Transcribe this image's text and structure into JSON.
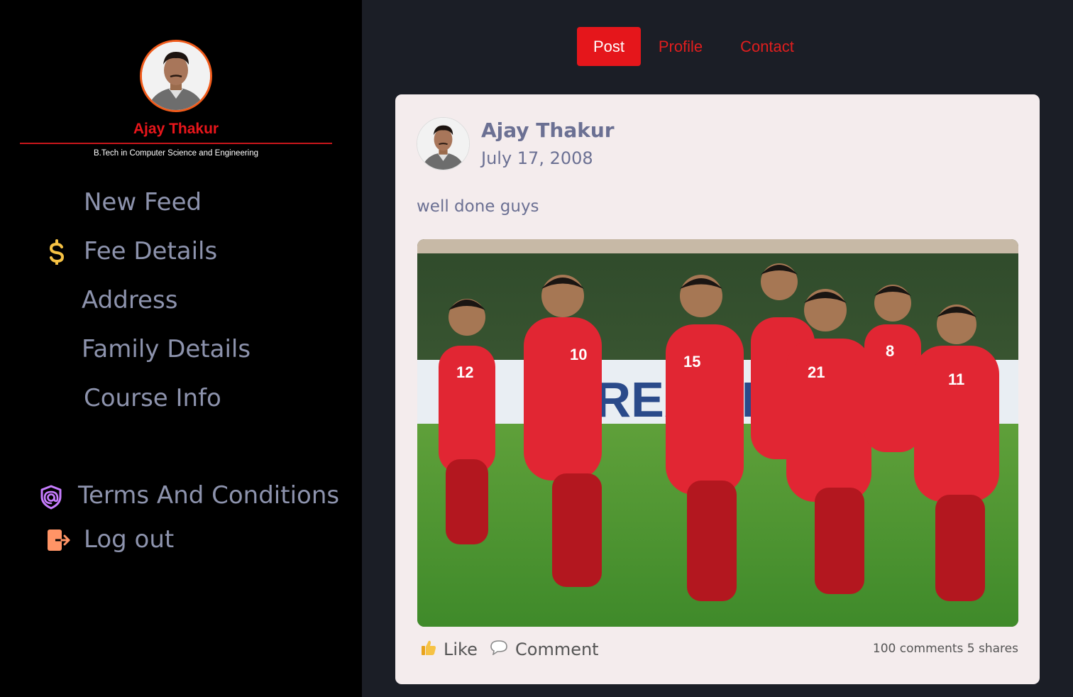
{
  "profile": {
    "name": "Ajay Thakur",
    "degree": "B.Tech in Computer Science and Engineering"
  },
  "sidebar": {
    "items": [
      {
        "label": "New Feed",
        "icon": "none"
      },
      {
        "label": "Fee Details",
        "icon": "dollar-icon"
      },
      {
        "label": "Address",
        "icon": "none"
      },
      {
        "label": "Family Details",
        "icon": "none"
      },
      {
        "label": "Course Info",
        "icon": "none"
      }
    ],
    "bottom": [
      {
        "label": "Terms And Conditions",
        "icon": "shield-at-icon"
      },
      {
        "label": "Log out",
        "icon": "logout-icon"
      }
    ]
  },
  "tabs": [
    {
      "label": "Post",
      "active": true
    },
    {
      "label": "Profile",
      "active": false
    },
    {
      "label": "Contact",
      "active": false
    }
  ],
  "post": {
    "author": "Ajay Thakur",
    "date": "July 17, 2008",
    "text": "well done guys",
    "like_label": "Like",
    "comment_label": "Comment",
    "stats": "100 comments 5 shares"
  },
  "colors": {
    "accent_red": "#e5161b",
    "sidebar_bg": "#000000",
    "main_bg": "#1b1e26",
    "card_bg": "#f4eced",
    "nav_text": "#8d93ad",
    "dollar_icon": "#f6c244",
    "shield_icon": "#c77dff",
    "logout_icon": "#ff9466"
  }
}
